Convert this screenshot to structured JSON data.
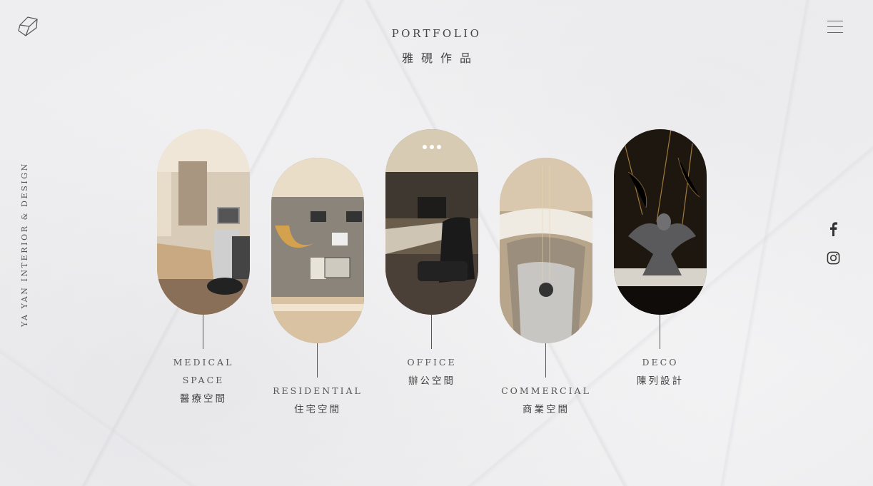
{
  "header": {
    "title_en": "PORTFOLIO",
    "title_zh": "雅硯作品"
  },
  "brand": {
    "vertical_text": "YA YAN INTERIOR & DESIGN",
    "logo_icon": "diamond-cube-icon"
  },
  "nav": {
    "menu_icon": "hamburger-menu-icon"
  },
  "social": [
    {
      "name": "facebook",
      "icon": "facebook-icon"
    },
    {
      "name": "instagram",
      "icon": "instagram-icon"
    }
  ],
  "categories": [
    {
      "en_line1": "MEDICAL",
      "en_line2": "SPACE",
      "zh": "醫療空間"
    },
    {
      "en_line1": "RESIDENTIAL",
      "zh": "住宅空間"
    },
    {
      "en_line1": "OFFICE",
      "zh": "辦公空間"
    },
    {
      "en_line1": "COMMERCIAL",
      "zh": "商業空間"
    },
    {
      "en_line1": "DECO",
      "zh": "陳列設計"
    }
  ],
  "colors": {
    "text": "#3a3a3a",
    "line": "#555555",
    "background": "#f3f3f4"
  }
}
